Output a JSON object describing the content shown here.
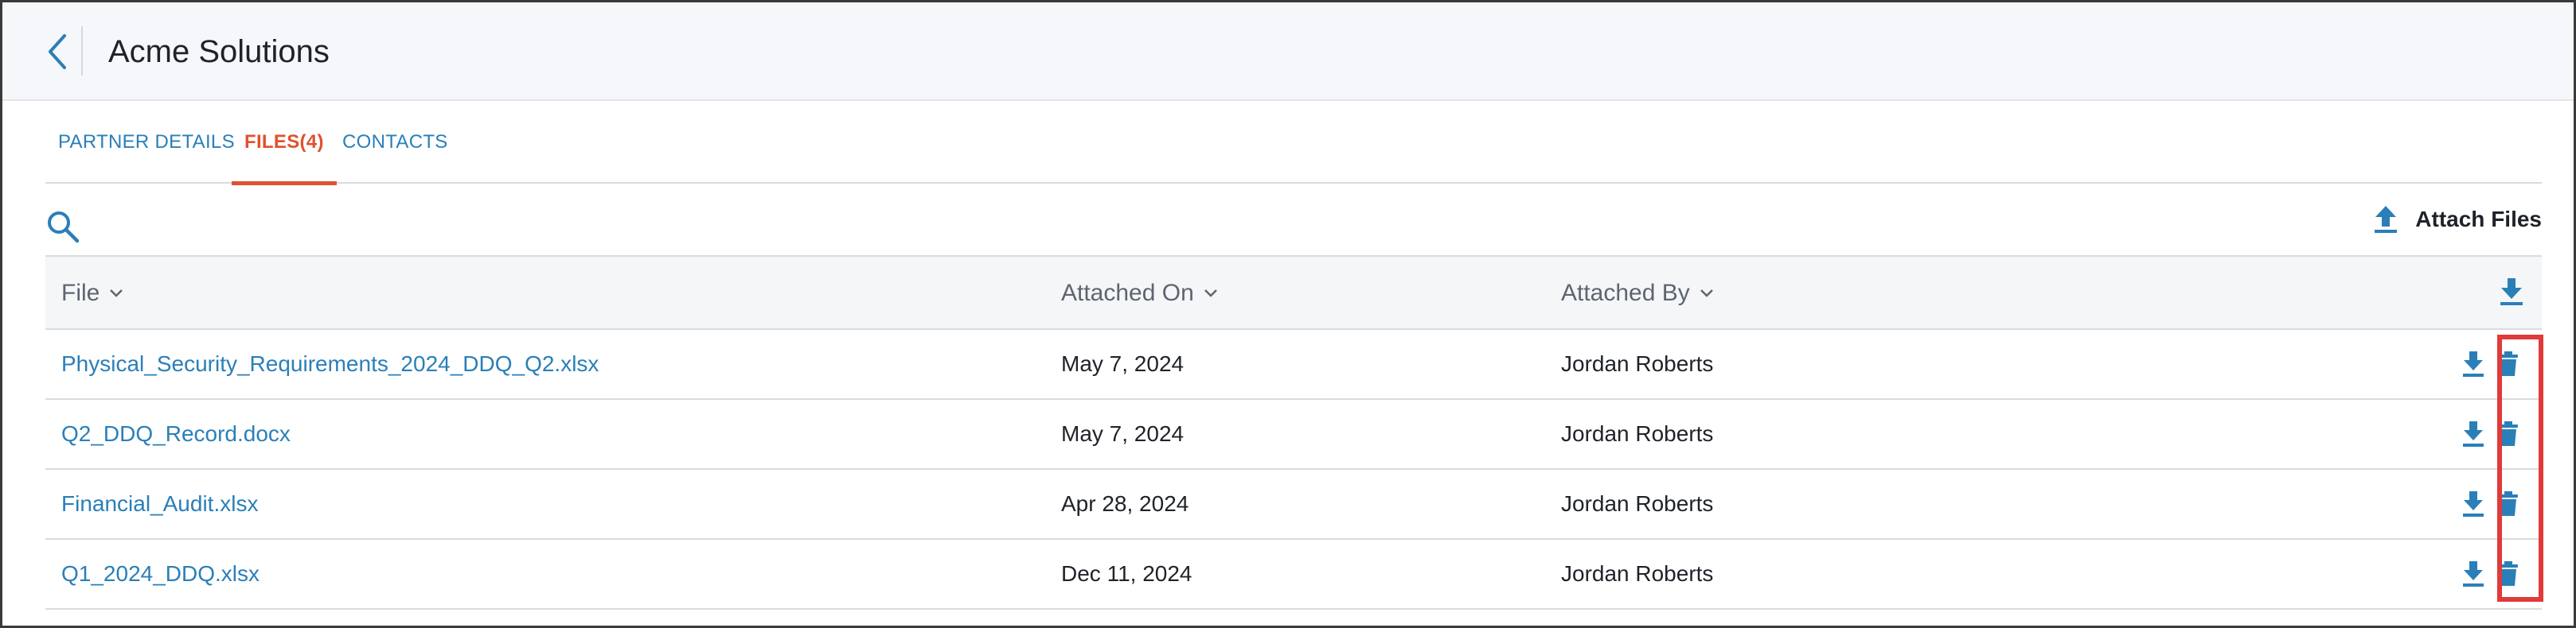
{
  "header": {
    "title": "Acme Solutions",
    "back_icon": "chevron-left-icon"
  },
  "tabs": [
    {
      "label": "PARTNER DETAILS",
      "active": false
    },
    {
      "label": "FILES(4)",
      "active": true
    },
    {
      "label": "CONTACTS",
      "active": false
    }
  ],
  "toolbar": {
    "search_icon": "search-icon",
    "attach_label": "Attach Files",
    "attach_icon": "upload-icon"
  },
  "table": {
    "columns": [
      {
        "label": "File",
        "sortable": true
      },
      {
        "label": "Attached On",
        "sortable": true
      },
      {
        "label": "Attached By",
        "sortable": true
      }
    ],
    "download_all_icon": "download-icon",
    "rows": [
      {
        "file": "Physical_Security_Requirements_2024_DDQ_Q2.xlsx",
        "attached_on": "May 7, 2024",
        "attached_by": "Jordan Roberts"
      },
      {
        "file": "Q2_DDQ_Record.docx",
        "attached_on": "May 7, 2024",
        "attached_by": "Jordan Roberts"
      },
      {
        "file": "Financial_Audit.xlsx",
        "attached_on": "Apr 28, 2024",
        "attached_by": "Jordan Roberts"
      },
      {
        "file": "Q1_2024_DDQ.xlsx",
        "attached_on": "Dec 11, 2024",
        "attached_by": "Jordan Roberts"
      }
    ]
  },
  "colors": {
    "link": "#2a7fb8",
    "active_tab": "#e0512f",
    "highlight": "#e03a3a"
  }
}
